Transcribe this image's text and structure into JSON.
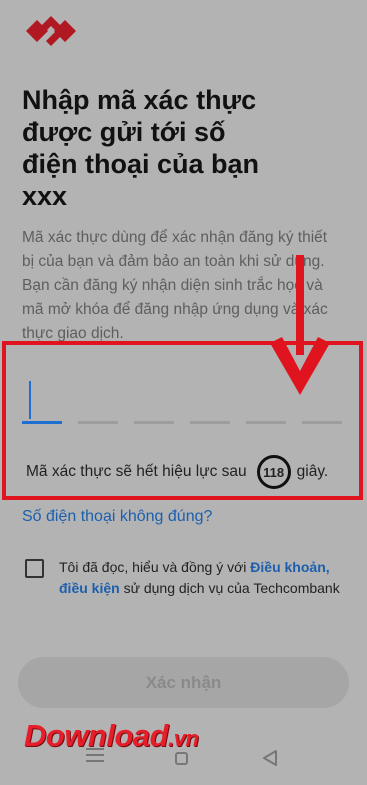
{
  "title_lines": [
    "Nhập mã xác thực",
    "được gửi tới số",
    "điện thoại của bạn",
    "xxx"
  ],
  "description_lines": [
    "Mã xác thực dùng để xác nhận đăng ký thiết",
    "bị của bạn và đảm bảo an toàn khi sử dụng.",
    "Bạn cần đăng ký nhận diện sinh trắc học và",
    "mã mở khóa để đăng nhập ứng dụng và xác",
    "thực giao dịch."
  ],
  "otp": {
    "digit_count": 6,
    "entered_value": ""
  },
  "expiry": {
    "prefix": "Mã xác thực sẽ hết hiệu lực sau",
    "seconds": "118",
    "suffix": "giây."
  },
  "wrong_phone_link": "Số điện thoại không đúng?",
  "terms": {
    "checked": false,
    "part1": "Tôi đã đọc, hiểu và đồng ý với ",
    "link": "Điều khoản, điều kiện",
    "part2": " sử dụng dịch vụ của Techcombank"
  },
  "confirm_button": "Xác nhận",
  "watermark": {
    "main": "Download",
    "tld": ".vn"
  },
  "colors": {
    "highlight": "#e0141e",
    "link": "#1c5fae",
    "brand": "#d6212b",
    "overlay_bg": "#b3b3b3"
  },
  "icons": [
    "techcombank-logo-icon",
    "red-arrow-down-icon",
    "menu-icon",
    "home-icon",
    "back-icon"
  ]
}
